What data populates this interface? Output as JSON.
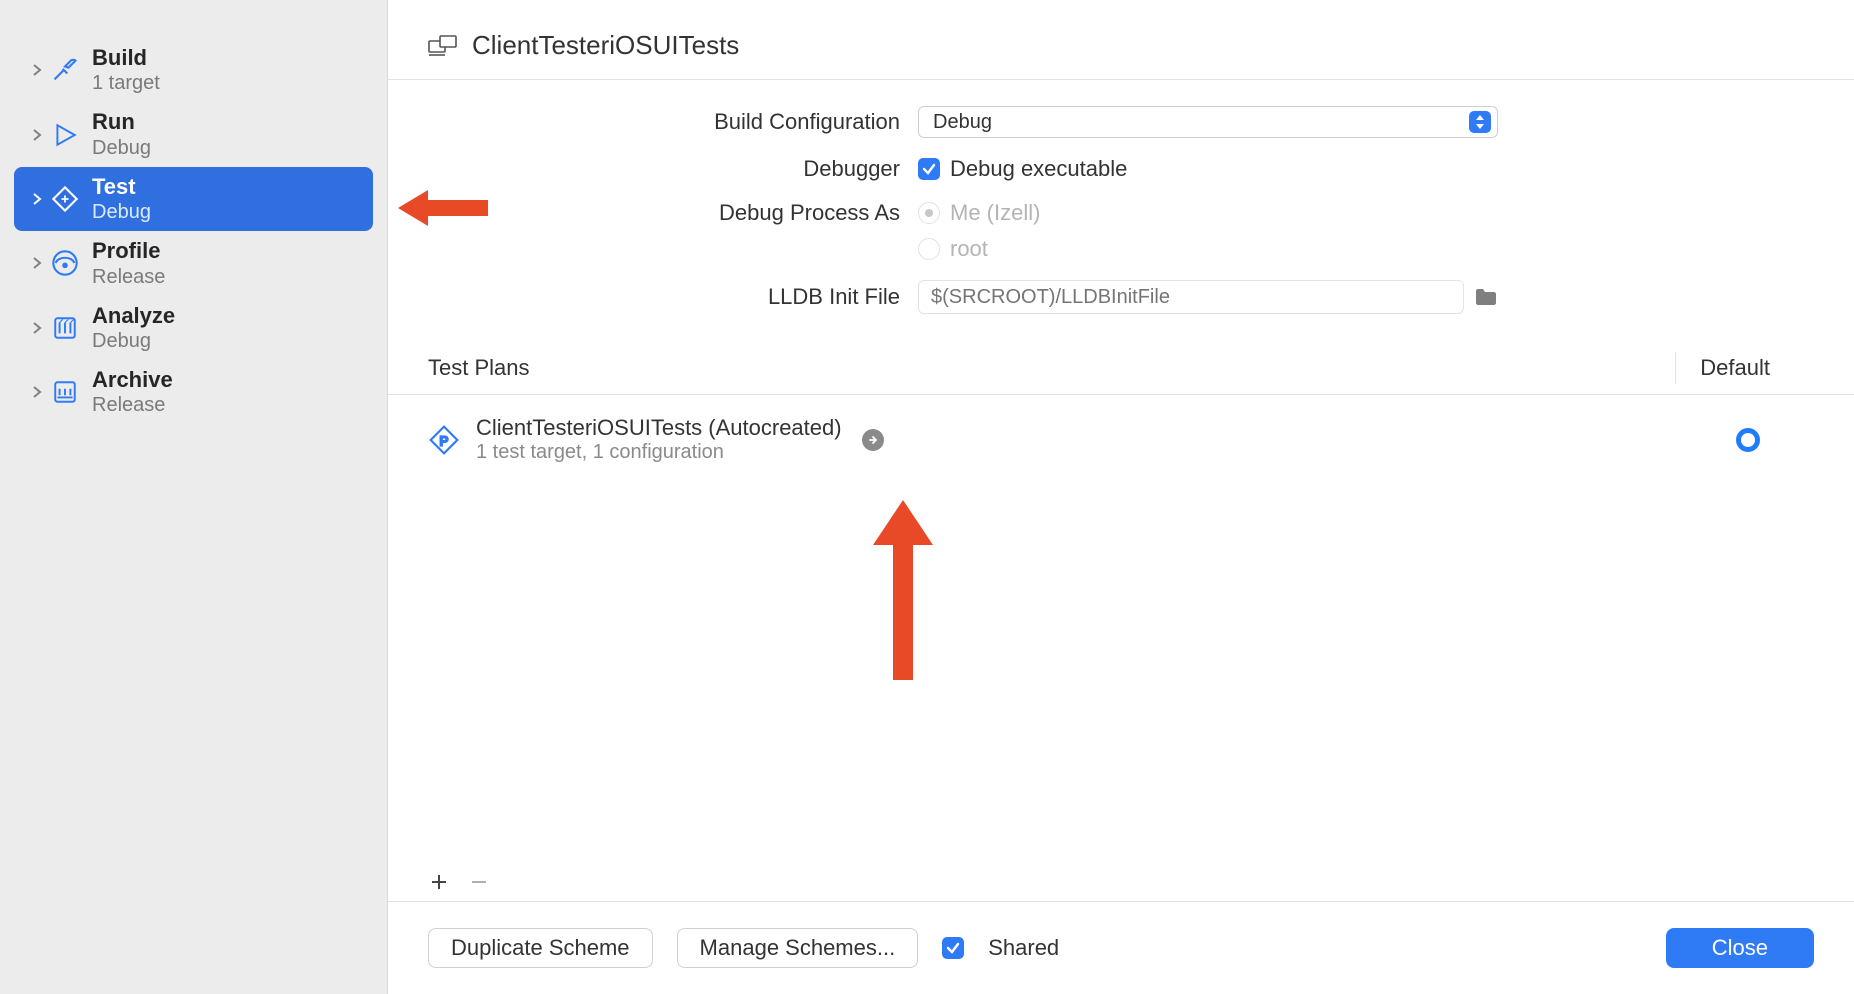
{
  "sidebar": {
    "items": [
      {
        "title": "Build",
        "subtitle": "1 target"
      },
      {
        "title": "Run",
        "subtitle": "Debug"
      },
      {
        "title": "Test",
        "subtitle": "Debug"
      },
      {
        "title": "Profile",
        "subtitle": "Release"
      },
      {
        "title": "Analyze",
        "subtitle": "Debug"
      },
      {
        "title": "Archive",
        "subtitle": "Release"
      }
    ]
  },
  "header": {
    "scheme_name": "ClientTesteriOSUITests"
  },
  "form": {
    "build_config_label": "Build Configuration",
    "build_config_value": "Debug",
    "debugger_label": "Debugger",
    "debug_executable_label": "Debug executable",
    "debug_process_as_label": "Debug Process As",
    "debug_process_me_label": "Me (Izell)",
    "debug_process_root_label": "root",
    "lldb_init_label": "LLDB Init File",
    "lldb_placeholder": "$(SRCROOT)/LLDBInitFile"
  },
  "test_plans": {
    "section_label": "Test Plans",
    "default_header": "Default",
    "plan_title": "ClientTesteriOSUITests (Autocreated)",
    "plan_subtitle": "1 test target, 1 configuration"
  },
  "footer": {
    "duplicate": "Duplicate Scheme",
    "manage": "Manage Schemes...",
    "shared": "Shared",
    "close": "Close"
  },
  "annotation_color": "#e84a27"
}
